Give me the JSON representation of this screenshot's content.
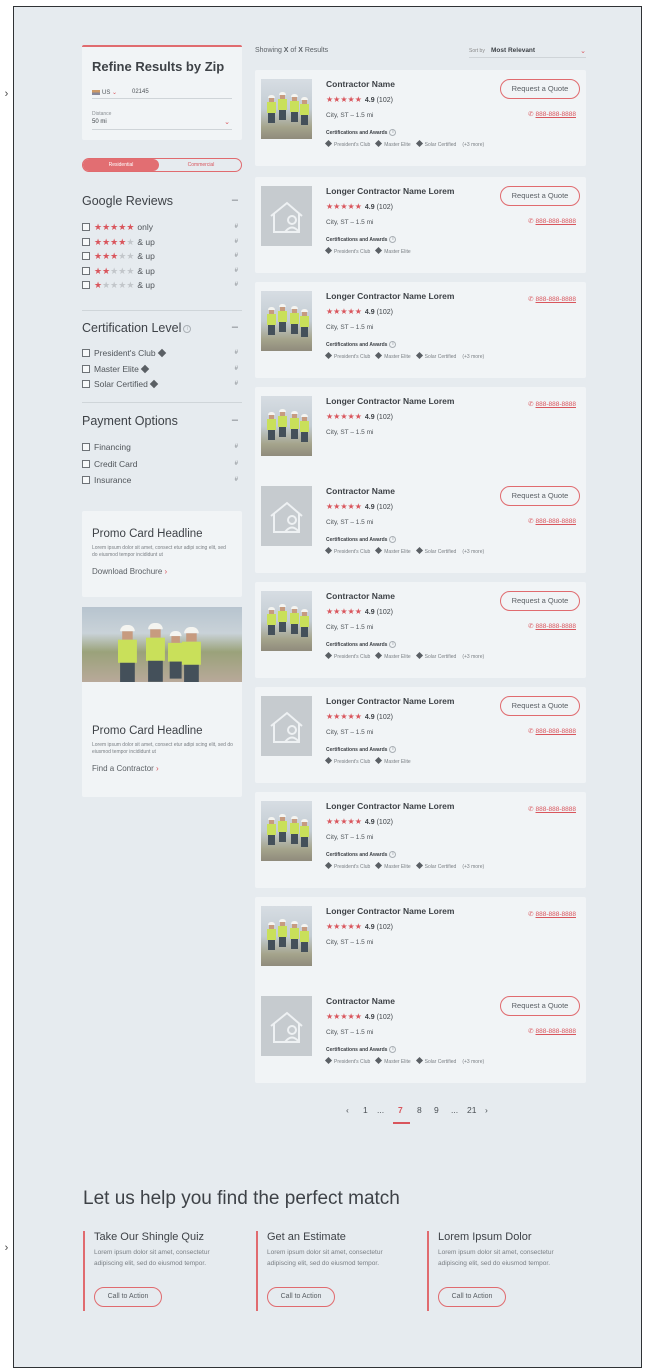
{
  "refine": {
    "title": "Refine Results by Zip",
    "country": "US",
    "zip": "02145",
    "distance_label": "Distance",
    "distance_value": "50 mi",
    "toggle_residential": "Residential",
    "toggle_commercial": "Commercial"
  },
  "filters": {
    "google_reviews": {
      "title": "Google Reviews",
      "rows": [
        {
          "filled": 5,
          "label": "only",
          "count": "#"
        },
        {
          "filled": 4,
          "label": "& up",
          "count": "#"
        },
        {
          "filled": 3,
          "label": "& up",
          "count": "#"
        },
        {
          "filled": 2,
          "label": "& up",
          "count": "#"
        },
        {
          "filled": 1,
          "label": "& up",
          "count": "#"
        }
      ]
    },
    "certification": {
      "title": "Certification Level",
      "rows": [
        {
          "label": "President's Club",
          "count": "#"
        },
        {
          "label": "Master Elite",
          "count": "#"
        },
        {
          "label": "Solar Certified",
          "count": "#"
        }
      ]
    },
    "payment": {
      "title": "Payment Options",
      "rows": [
        {
          "label": "Financing",
          "count": "#"
        },
        {
          "label": "Credit Card",
          "count": "#"
        },
        {
          "label": "Insurance",
          "count": "#"
        }
      ]
    }
  },
  "promos": [
    {
      "headline": "Promo Card Headline",
      "body": "Lorem ipsum dolor sit amet, consect etur adipi scing elit, sed do eiusmod tempor incididunt ut",
      "link": "Download Brochure"
    },
    {
      "headline": "Promo Card Headline",
      "body": "Lorem ipsum dolor sit amet, consect etur adipi scing elit, sed do eiusmod tempor incididunt ut",
      "link": "Find a Contractor"
    }
  ],
  "results_header": {
    "showing_prefix": "Showing ",
    "x1": "X",
    "of": " of ",
    "x2": "X",
    "suffix": " Results",
    "sort_label": "Sort by",
    "sort_value": "Most Relevant"
  },
  "contractors": [
    {
      "name": "Contractor Name",
      "rating": "4.9",
      "reviews": "(102)",
      "location": "City, ST – 1.5 mi",
      "photo": true,
      "quote": true,
      "certs": [
        "President's Club",
        "Master Elite",
        "Solar Certified"
      ],
      "more": "(+3 more)"
    },
    {
      "name": "Longer Contractor Name Lorem",
      "rating": "4.9",
      "reviews": "(102)",
      "location": "City, ST – 1.5 mi",
      "photo": false,
      "quote": true,
      "certs": [
        "President's Club",
        "Master Elite"
      ],
      "more": ""
    },
    {
      "name": "Longer Contractor Name Lorem",
      "rating": "4.9",
      "reviews": "(102)",
      "location": "City, ST – 1.5 mi",
      "photo": true,
      "quote": false,
      "certs": [
        "President's Club",
        "Master Elite",
        "Solar Certified"
      ],
      "more": "(+3 more)"
    },
    {
      "name": "Longer Contractor Name Lorem",
      "rating": "4.9",
      "reviews": "(102)",
      "location": "City, ST – 1.5 mi",
      "photo": true,
      "quote": false,
      "certs": [],
      "more": ""
    },
    {
      "name": "Contractor Name",
      "rating": "4.9",
      "reviews": "(102)",
      "location": "City, ST – 1.5 mi",
      "photo": false,
      "quote": true,
      "certs": [
        "President's Club",
        "Master Elite",
        "Solar Certified"
      ],
      "more": "(+3 more)"
    },
    {
      "name": "Contractor Name",
      "rating": "4.9",
      "reviews": "(102)",
      "location": "City, ST – 1.5 mi",
      "photo": true,
      "quote": true,
      "certs": [
        "President's Club",
        "Master Elite",
        "Solar Certified"
      ],
      "more": "(+3 more)"
    },
    {
      "name": "Longer Contractor Name Lorem",
      "rating": "4.9",
      "reviews": "(102)",
      "location": "City, ST – 1.5 mi",
      "photo": false,
      "quote": true,
      "certs": [
        "President's Club",
        "Master Elite"
      ],
      "more": ""
    },
    {
      "name": "Longer Contractor Name Lorem",
      "rating": "4.9",
      "reviews": "(102)",
      "location": "City, ST – 1.5 mi",
      "photo": true,
      "quote": false,
      "certs": [
        "President's Club",
        "Master Elite",
        "Solar Certified"
      ],
      "more": "(+3 more)"
    },
    {
      "name": "Longer Contractor Name Lorem",
      "rating": "4.9",
      "reviews": "(102)",
      "location": "City, ST – 1.5 mi",
      "photo": true,
      "quote": false,
      "certs": [],
      "more": ""
    },
    {
      "name": "Contractor Name",
      "rating": "4.9",
      "reviews": "(102)",
      "location": "City, ST – 1.5 mi",
      "photo": false,
      "quote": true,
      "certs": [
        "President's Club",
        "Master Elite",
        "Solar Certified"
      ],
      "more": "(+3 more)"
    }
  ],
  "card_labels": {
    "quote": "Request a Quote",
    "phone": "888-888-8888",
    "certs_heading": "Certifications and Awards"
  },
  "pagination": {
    "prev": "‹",
    "p1": "1",
    "ellipsis1": "...",
    "current": "7",
    "p8": "8",
    "p9": "9",
    "ellipsis2": "...",
    "last": "21",
    "next": "›"
  },
  "help": {
    "title": "Let us help you find the perfect match",
    "columns": [
      {
        "heading": "Take Our Shingle Quiz",
        "body": "Lorem ipsum dolor sit amet, consectetur adipiscing elit, sed do eiusmod tempor.",
        "cta": "Call to Action"
      },
      {
        "heading": "Get an Estimate",
        "body": "Lorem ipsum dolor sit amet, consectetur adipiscing elit, sed do eiusmod tempor.",
        "cta": "Call to Action"
      },
      {
        "heading": "Lorem Ipsum Dolor",
        "body": "Lorem ipsum dolor sit amet, consectetur adipiscing elit, sed do eiusmod tempor.",
        "cta": "Call to Action"
      }
    ]
  },
  "colors": {
    "accent": "#e06b6f",
    "star": "#d9555c",
    "page_bg": "#e6ebef",
    "card_bg": "#f1f4f6"
  },
  "icons": {
    "left_edge_markers": "chevron-right-icon",
    "placeholder": "house-person-icon",
    "phone": "phone-icon"
  }
}
